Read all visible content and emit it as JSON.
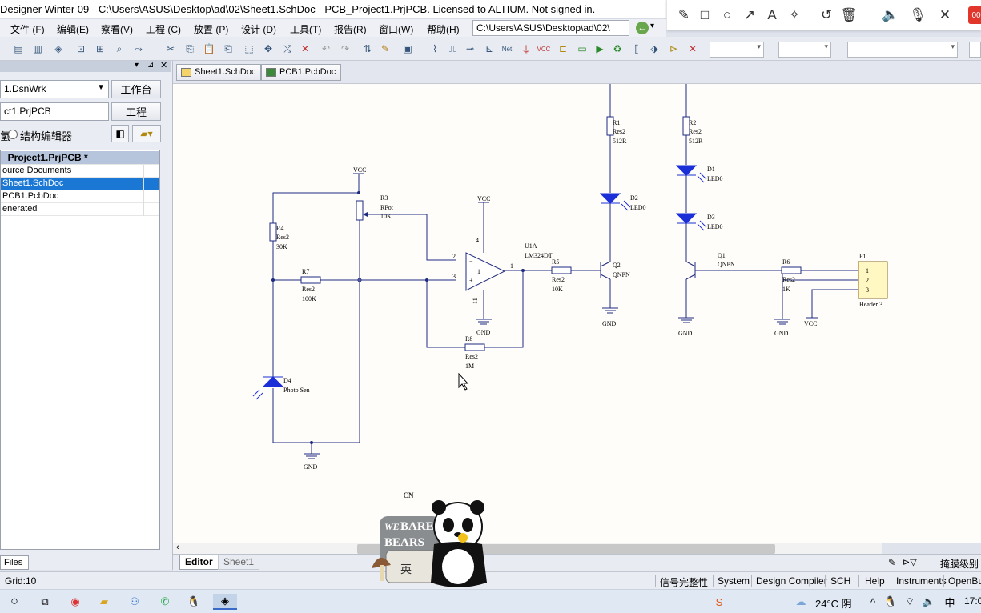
{
  "title": "Designer Winter 09 - C:\\Users\\ASUS\\Desktop\\ad\\02\\Sheet1.SchDoc - PCB_Project1.PrjPCB. Licensed to ALTIUM. Not signed in.",
  "annotation_toolbar": {
    "badge": "00",
    "icons": [
      "pencil-icon",
      "rectangle-icon",
      "circle-icon",
      "arrow-icon",
      "text-icon",
      "magic-wand-icon",
      "undo-icon",
      "trash-icon",
      "speaker-icon",
      "microphone-icon",
      "close-icon"
    ]
  },
  "menu": [
    "文件 (F)",
    "编辑(E)",
    "察看(V)",
    "工程 (C)",
    "放置 (P)",
    "设计 (D)",
    "工具(T)",
    "报告(R)",
    "窗口(W)",
    "帮助(H)"
  ],
  "path_box": "C:\\Users\\ASUS\\Desktop\\ad\\02\\",
  "left_panel": {
    "workspace_value": "1.DsnWrk",
    "workspace_button": "工作台",
    "project_value": "ct1.PrjPCB",
    "project_button": "工程",
    "view_option_a": "结构编辑器",
    "view_option_a_prefix": "氢",
    "tree": [
      {
        "label": "_Project1.PrjPCB *",
        "kind": "header"
      },
      {
        "label": "ource Documents",
        "kind": "normal"
      },
      {
        "label": "Sheet1.SchDoc",
        "kind": "selected"
      },
      {
        "label": "PCB1.PcbDoc",
        "kind": "normal"
      },
      {
        "label": "enerated",
        "kind": "normal"
      }
    ],
    "files_tab": "Files"
  },
  "doc_tabs": [
    {
      "label": "Sheet1.SchDoc",
      "icon": "schematic-doc-icon"
    },
    {
      "label": "PCB1.PcbDoc",
      "icon": "pcb-doc-icon"
    }
  ],
  "schematic": {
    "components": [
      {
        "ref": "R1",
        "type": "Res2",
        "value": "512R"
      },
      {
        "ref": "R2",
        "type": "Res2",
        "value": "512R"
      },
      {
        "ref": "R3",
        "type": "RPot",
        "value": "10K"
      },
      {
        "ref": "R4",
        "type": "Res2",
        "value": "30K"
      },
      {
        "ref": "R5",
        "type": "Res2",
        "value": "10K"
      },
      {
        "ref": "R6",
        "type": "Res2",
        "value": "1K"
      },
      {
        "ref": "R7",
        "type": "Res2",
        "value": "100K"
      },
      {
        "ref": "R8",
        "type": "Res2",
        "value": "1M"
      },
      {
        "ref": "D1",
        "type": "LED0"
      },
      {
        "ref": "D2",
        "type": "LED0"
      },
      {
        "ref": "D3",
        "type": "LED0"
      },
      {
        "ref": "D4",
        "type": "Photo Sen"
      },
      {
        "ref": "Q1",
        "type": "QNPN"
      },
      {
        "ref": "Q2",
        "type": "QNPN"
      },
      {
        "ref": "U1A",
        "type": "LM324DT"
      },
      {
        "ref": "P1",
        "type": "Header 3"
      }
    ],
    "power_labels": {
      "vcc": "VCC",
      "gnd": "GND"
    },
    "pins": {
      "opamp_in_neg": "2",
      "opamp_in_pos": "3",
      "opamp_out": "1",
      "opamp_vcc": "4",
      "opamp_gnd": "11",
      "opamp_center": "1",
      "header": [
        "1",
        "2",
        "3"
      ]
    }
  },
  "bottom_tabs": [
    "Editor",
    "Sheet1"
  ],
  "bottom_right": "掩膜级别",
  "status": {
    "grid": "Grid:10",
    "items": [
      "信号完整性",
      "System",
      "Design Compiler",
      "SCH",
      "Help",
      "Instruments",
      "OpenBu"
    ]
  },
  "taskbar": {
    "weather": "24°C 阴",
    "clock": "17:0",
    "ime": "英"
  },
  "sticker": {
    "brand_small": "CN",
    "brand_line1": "WE",
    "brand_line2": "BARE",
    "brand_line3": "BEARS"
  }
}
